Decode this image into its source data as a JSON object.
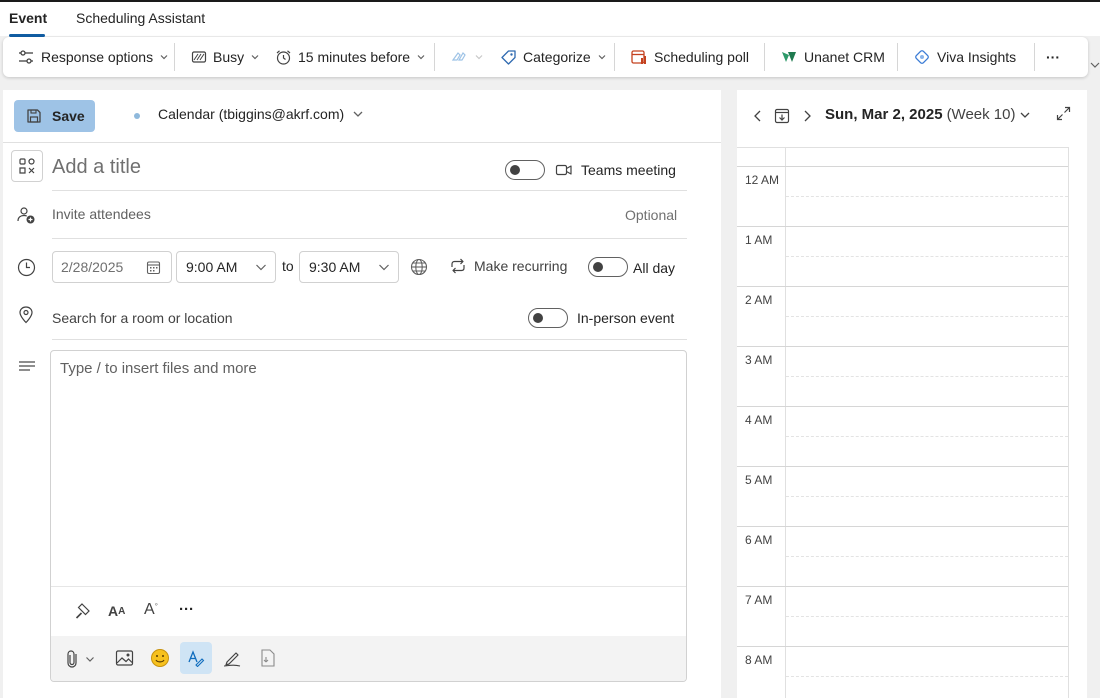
{
  "tabs": [
    {
      "label": "Event",
      "active": true
    },
    {
      "label": "Scheduling Assistant",
      "active": false
    }
  ],
  "ribbon": {
    "response_options": "Response options",
    "busy": "Busy",
    "reminder": "15 minutes before",
    "categorize": "Categorize",
    "scheduling_poll": "Scheduling poll",
    "crm": "Unanet CRM",
    "viva": "Viva Insights",
    "more": "···"
  },
  "form": {
    "save_label": "Save",
    "calendar": "Calendar (tbiggins@akrf.com)",
    "title_placeholder": "Add a title",
    "teams_meeting": "Teams meeting",
    "invite_placeholder": "Invite attendees",
    "optional": "Optional",
    "date": "2/28/2025",
    "start_time": "9:00 AM",
    "to": "to",
    "end_time": "9:30 AM",
    "make_recurring": "Make recurring",
    "all_day": "All day",
    "location_placeholder": "Search for a room or location",
    "in_person": "In-person event",
    "body_placeholder": "Type / to insert files and more",
    "format_more": "···"
  },
  "calendar": {
    "date": "Sun, Mar 2, 2025",
    "week": "(Week 10)",
    "hours": [
      "12 AM",
      "1 AM",
      "2 AM",
      "3 AM",
      "4 AM",
      "5 AM",
      "6 AM",
      "7 AM",
      "8 AM"
    ]
  },
  "colors": {
    "accent": "#115ea3",
    "save_bg": "#9ec3e6",
    "calendar_dot": "#8fb9dc"
  }
}
